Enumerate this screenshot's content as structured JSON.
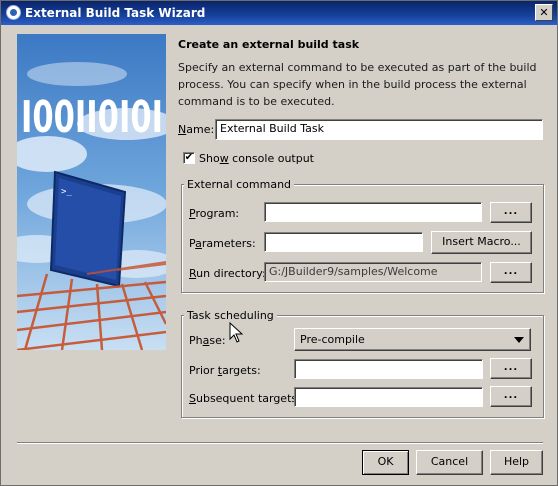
{
  "window": {
    "title": "External Build Task Wizard"
  },
  "heading": "Create an external build task",
  "description": "Specify an external command to be executed as part of the build process. You can specify when in the build process the external command is to be executed.",
  "name_field": {
    "label": "Name:",
    "value": "External Build Task"
  },
  "show_console": {
    "label": "Show console output",
    "checked": true
  },
  "external_command": {
    "group_label": "External command",
    "program_label": "Program:",
    "program_value": "",
    "parameters_label": "Parameters:",
    "parameters_value": "",
    "insert_macro_label": "Insert Macro...",
    "run_directory_label": "Run directory:",
    "run_directory_value": "G:/JBuilder9/samples/Welcome",
    "browse_label": "..."
  },
  "task_scheduling": {
    "group_label": "Task scheduling",
    "phase_label": "Phase:",
    "phase_value": "Pre-compile",
    "prior_targets_label": "Prior targets:",
    "prior_targets_value": "",
    "subsequent_targets_label": "Subsequent targets:",
    "subsequent_targets_value": ""
  },
  "buttons": {
    "ok": "OK",
    "cancel": "Cancel",
    "help": "Help"
  },
  "art": {
    "binary_text": "I00II0I0I",
    "prompt": ">_"
  }
}
